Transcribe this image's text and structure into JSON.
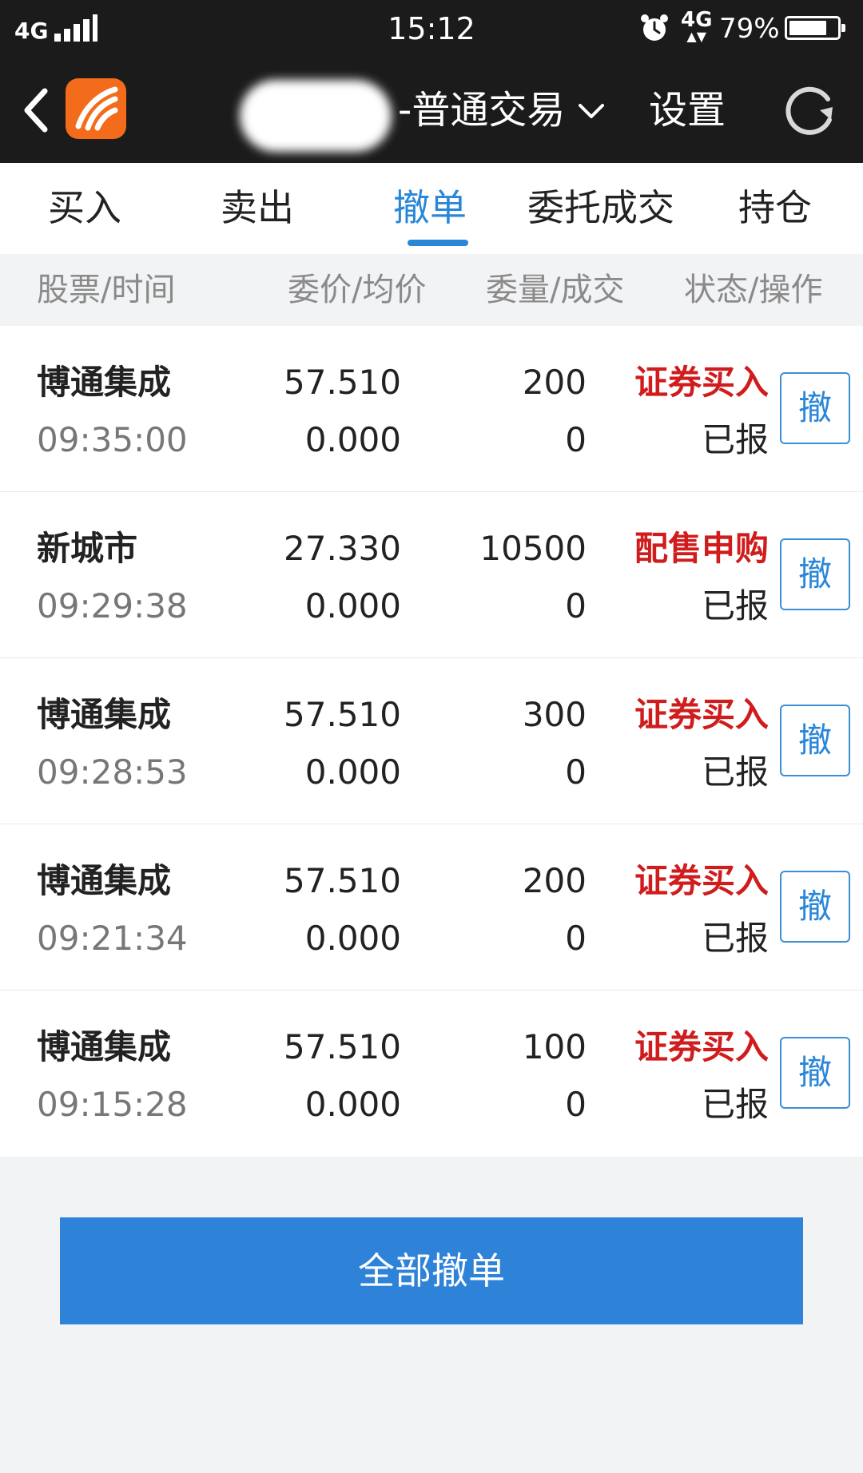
{
  "status_bar": {
    "network": "4G",
    "time": "15:12",
    "network2": "4G",
    "battery": "79%",
    "battery_level": 0.79
  },
  "header": {
    "title": "-普通交易",
    "settings_label": "设置",
    "icons": [
      "back-icon",
      "app-logo",
      "chevron-down-icon",
      "refresh-icon"
    ]
  },
  "tabs": [
    {
      "label": "买入"
    },
    {
      "label": "卖出"
    },
    {
      "label": "撤单",
      "active": true
    },
    {
      "label": "委托成交"
    },
    {
      "label": "持仓"
    }
  ],
  "columns": {
    "stock_time": "股票/时间",
    "price_avg": "委价/均价",
    "qty_filled": "委量/成交",
    "status_action": "状态/操作"
  },
  "orders": [
    {
      "name": "博通集成",
      "time": "09:35:00",
      "price": "57.510",
      "avg_price": "0.000",
      "qty": "200",
      "filled": "0",
      "type": "证券买入",
      "status": "已报",
      "action": "撤"
    },
    {
      "name": "新城市",
      "time": "09:29:38",
      "price": "27.330",
      "avg_price": "0.000",
      "qty": "10500",
      "filled": "0",
      "type": "配售申购",
      "status": "已报",
      "action": "撤"
    },
    {
      "name": "博通集成",
      "time": "09:28:53",
      "price": "57.510",
      "avg_price": "0.000",
      "qty": "300",
      "filled": "0",
      "type": "证券买入",
      "status": "已报",
      "action": "撤"
    },
    {
      "name": "博通集成",
      "time": "09:21:34",
      "price": "57.510",
      "avg_price": "0.000",
      "qty": "200",
      "filled": "0",
      "type": "证券买入",
      "status": "已报",
      "action": "撤"
    },
    {
      "name": "博通集成",
      "time": "09:15:28",
      "price": "57.510",
      "avg_price": "0.000",
      "qty": "100",
      "filled": "0",
      "type": "证券买入",
      "status": "已报",
      "action": "撤"
    }
  ],
  "cancel_all_label": "全部撤单",
  "colors": {
    "accent": "#2a87d8",
    "header_bg": "#1b1b1b",
    "buy_red": "#d01c1c",
    "logo_orange": "#f26c1b"
  }
}
